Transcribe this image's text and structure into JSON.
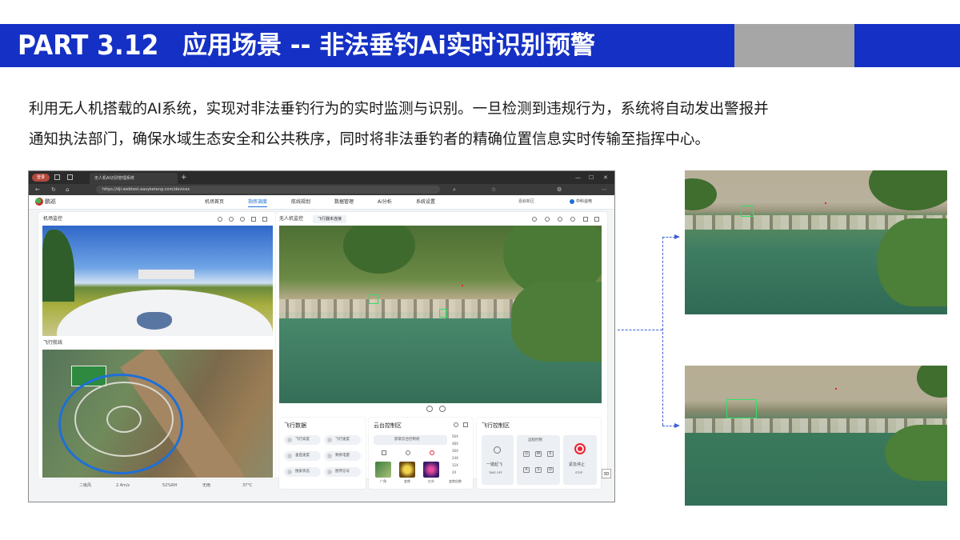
{
  "header": {
    "part": "PART 3.12",
    "title": "应用场景 -- 非法垂钓Ai实时识别预警",
    "colors": {
      "blue": "#1530c4",
      "gray": "#a6a6a6"
    }
  },
  "description": {
    "line1": "利用无人机搭载的AI系统，实现对非法垂钓行为的实时监测与识别。一旦检测到违规行为，系统将自动发出警报并",
    "line2": "通知执法部门，确保水域生态安全和公共秩序，同时将非法垂钓者的精确位置信息实时传输至指挥中心。"
  },
  "screenshot": {
    "browser": {
      "login": "登录",
      "tab_title": "无人机AI识别管理系统",
      "address": "https://dji-webtest.easyketang.com/devices"
    },
    "app": {
      "name": "鹏巡",
      "nav": [
        "机场首页",
        "指挥调度",
        "航线规划",
        "数据管理",
        "Ai分析",
        "系统设置"
      ],
      "active_nav": "指挥调度",
      "region": "嘉峪新区",
      "user": "中科遥电"
    },
    "left_panel": {
      "title": "机场监控",
      "route_title": "飞行航线"
    },
    "video_panel": {
      "title": "无人机监控",
      "status": "飞行器未连接"
    },
    "flight_data": {
      "title": "飞行数据",
      "chips": [
        "飞行高度",
        "飞行速度",
        "垂直速度",
        "剩余电量",
        "搜索状态",
        "图传信号"
      ]
    },
    "gimbal": {
      "title": "云台控制区",
      "get_control": "获取云台控制权",
      "modes": [
        "广角",
        "变焦",
        "红外"
      ],
      "zoom_levels": [
        "56X",
        "48X",
        "36X",
        "24X",
        "12X",
        "2X"
      ],
      "zoom_label": "变焦倍数"
    },
    "flight_control": {
      "title": "飞行控制区",
      "remote": "远程控制",
      "takeoff": "一键起飞",
      "takeoff_en": "TAKE OFF",
      "stop": "紧急停止",
      "stop_en": "STOP",
      "keys": [
        "Q",
        "W",
        "E",
        "A",
        "S",
        "D"
      ]
    },
    "status_bar": [
      "二级风",
      "2.4m/s",
      "52%RH",
      "无雨",
      "37°C"
    ],
    "view_3d": "3D"
  }
}
